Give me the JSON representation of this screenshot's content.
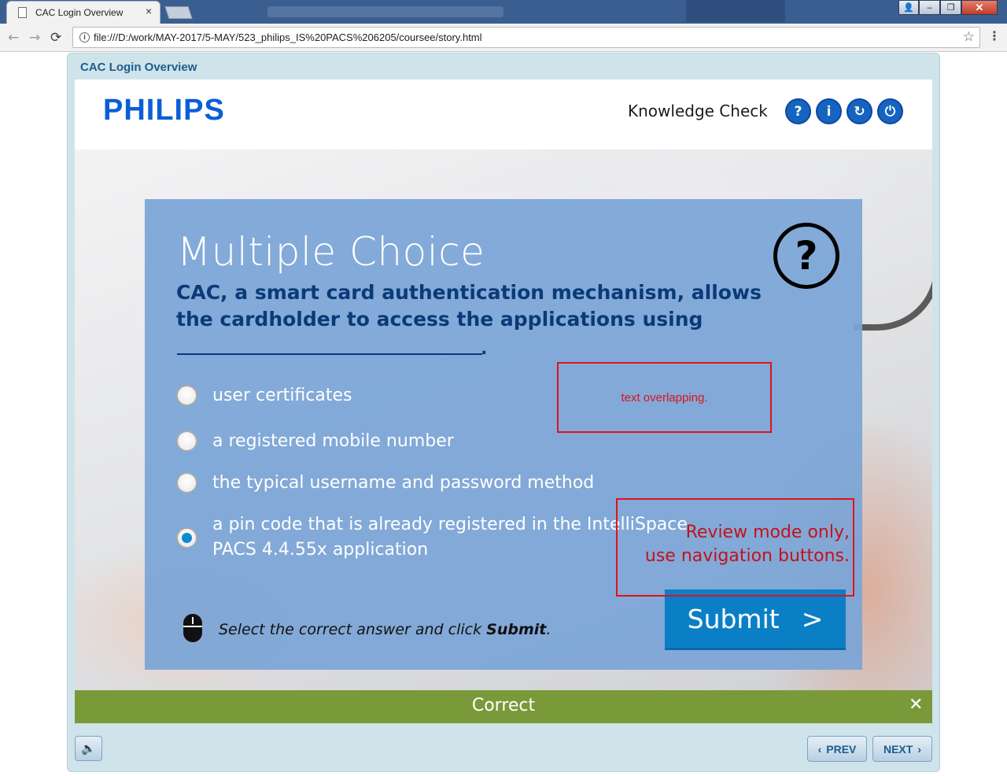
{
  "browser": {
    "tab_title": "CAC Login Overview",
    "tab_close": "×",
    "url": "file:///D:/work/MAY-2017/5-MAY/523_philips_IS%20PACS%206205/coursee/story.html",
    "back_icon": "←",
    "forward_icon": "→",
    "reload_icon": "⟳",
    "info_icon": "i",
    "star_icon": "☆",
    "menu_icon": "⋮",
    "window_controls": {
      "user": "👤",
      "minimize": "–",
      "maximize": "❐",
      "close": "✕"
    }
  },
  "player": {
    "title": "CAC Login Overview"
  },
  "header": {
    "logo": "PHILIPS",
    "section_label": "Knowledge Check",
    "buttons": {
      "help": "?",
      "info": "i",
      "replay": "↻",
      "exit": "⏻"
    }
  },
  "question": {
    "heading": "Multiple Choice",
    "icon": "?",
    "text": "CAC, a smart card authentication mechanism, allows the cardholder to access the applications using",
    "blank_period": ".",
    "options": [
      {
        "label": "user certificates",
        "selected": false
      },
      {
        "label": "a registered mobile number",
        "selected": false
      },
      {
        "label": "the typical username and password method",
        "selected": false
      },
      {
        "label_line1": "a pin code that is already registered in the  IntelliSpace",
        "label_line2": "PACS 4.4.55x application",
        "selected": true
      }
    ],
    "instruction_prefix": "Select the correct answer and click ",
    "instruction_bold": "Submit",
    "instruction_suffix": ".",
    "submit_label": "Submit",
    "submit_arrow": ">"
  },
  "feedback": {
    "text": "Correct",
    "close": "✕"
  },
  "annotations": {
    "note1": "text overlapping.",
    "note2_line1": "Review mode only,",
    "note2_line2": "use navigation buttons."
  },
  "footer": {
    "audio_icon": "🔈",
    "prev_arrow": "‹",
    "prev_label": "PREV",
    "next_label": "NEXT",
    "next_arrow": "›"
  },
  "colors": {
    "brand_blue": "#0b5ed7",
    "question_text": "#0b3a78",
    "panel": "#7ba5d6",
    "submit": "#0b7fc6",
    "feedback_green": "#7a9a3a",
    "annotation_red": "#e0121a"
  }
}
